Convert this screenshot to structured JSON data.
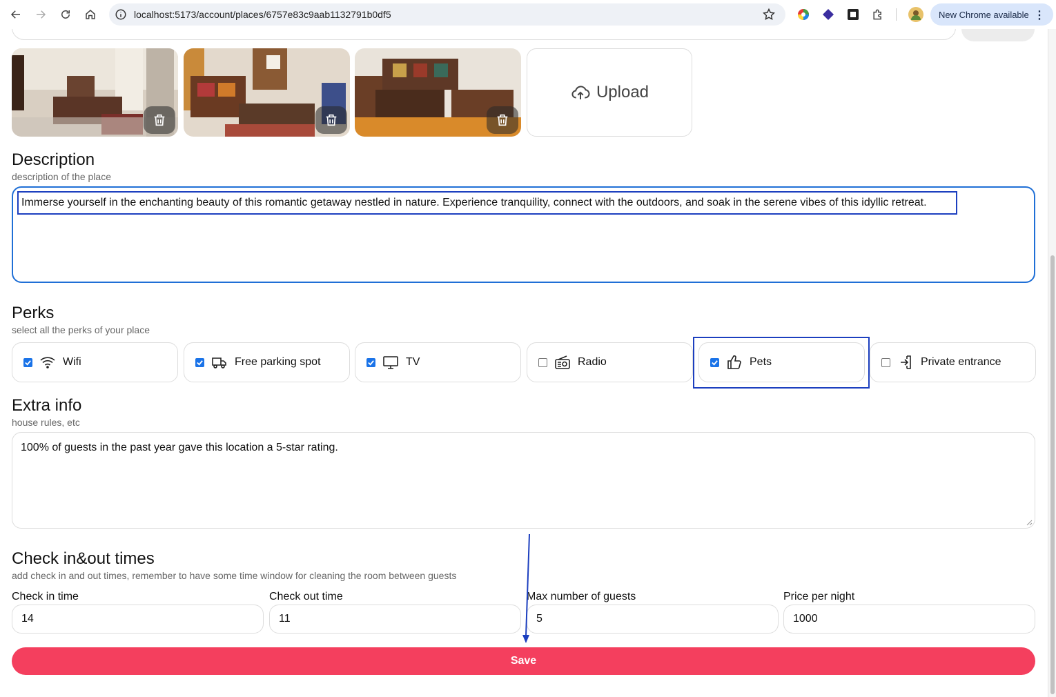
{
  "browser": {
    "url": "localhost:5173/account/places/6757e83c9aab1132791b0df5",
    "update_label": "New Chrome available"
  },
  "photos": [
    {
      "name": "photo-1",
      "alt_icon": "trash-icon"
    },
    {
      "name": "photo-2",
      "alt_icon": "trash-icon"
    },
    {
      "name": "photo-3",
      "alt_icon": "trash-icon"
    }
  ],
  "upload_label": "Upload",
  "description": {
    "title": "Description",
    "subtitle": "description of the place",
    "value": "Immerse yourself in the enchanting beauty of this romantic getaway nestled in nature. Experience tranquility, connect with the outdoors, and soak in the serene vibes of this idyllic retreat."
  },
  "perks": {
    "title": "Perks",
    "subtitle": "select all the perks of your place",
    "items": [
      {
        "label": "Wifi",
        "checked": true,
        "icon": "wifi-icon"
      },
      {
        "label": "Free parking spot",
        "checked": true,
        "icon": "truck-icon"
      },
      {
        "label": "TV",
        "checked": true,
        "icon": "monitor-icon"
      },
      {
        "label": "Radio",
        "checked": false,
        "icon": "radio-icon"
      },
      {
        "label": "Pets",
        "checked": true,
        "icon": "thumbs-up-icon"
      },
      {
        "label": "Private entrance",
        "checked": false,
        "icon": "entrance-icon"
      }
    ]
  },
  "extra": {
    "title": "Extra info",
    "subtitle": "house rules, etc",
    "value": "100% of guests in the past year gave this location a 5-star rating."
  },
  "times": {
    "title": "Check in&out times",
    "subtitle": "add check in and out times, remember to have some time window for cleaning the room between guests",
    "checkin_label": "Check in time",
    "checkin_value": "14",
    "checkout_label": "Check out time",
    "checkout_value": "11",
    "guests_label": "Max number of guests",
    "guests_value": "5",
    "price_label": "Price per night",
    "price_value": "1000"
  },
  "save_label": "Save",
  "colors": {
    "accent": "#f43f5e",
    "focus": "#1f6fd6",
    "annotation": "#1c3fbf"
  }
}
